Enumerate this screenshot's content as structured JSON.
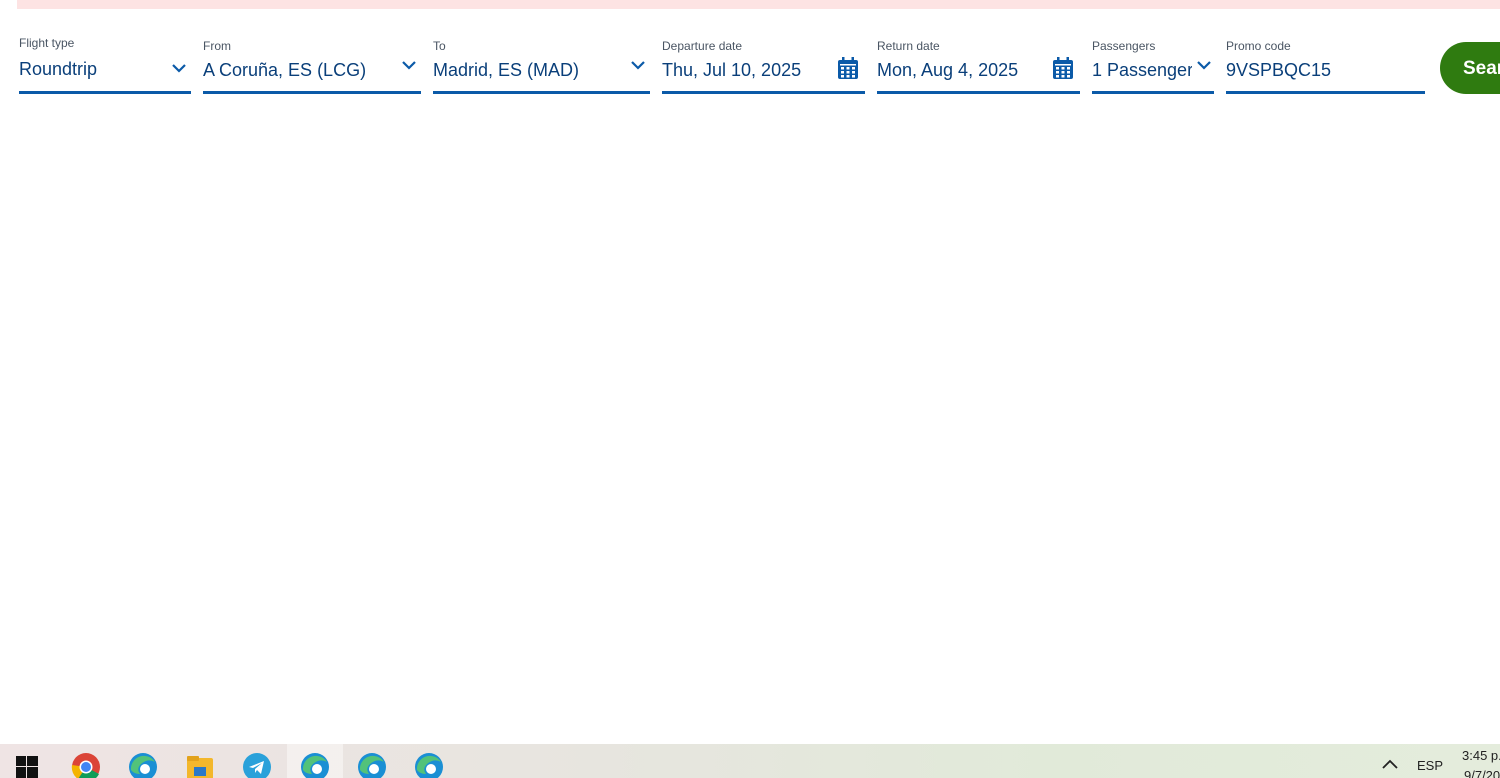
{
  "search_form": {
    "flight_type": {
      "label": "Flight type",
      "value": "Roundtrip"
    },
    "from": {
      "label": "From",
      "value": "A Coruña, ES (LCG)"
    },
    "to": {
      "label": "To",
      "value": "Madrid, ES (MAD)"
    },
    "departure_date": {
      "label": "Departure date",
      "value": "Thu, Jul 10, 2025"
    },
    "return_date": {
      "label": "Return date",
      "value": "Mon, Aug 4, 2025"
    },
    "passengers": {
      "label": "Passengers",
      "value": "1 Passenger"
    },
    "promo_code": {
      "label": "Promo code",
      "value": "9VSPBQC15"
    },
    "search_button_label": "Sear"
  },
  "taskbar": {
    "apps": [
      "windows-start-icon",
      "chrome-icon",
      "edge-icon",
      "file-explorer-icon",
      "telegram-icon",
      "edge-icon",
      "edge-icon",
      "edge-icon"
    ],
    "language": "ESP",
    "time": "3:45 p.",
    "date": "9/7/20"
  },
  "colors": {
    "accent_blue": "#0b5aa8",
    "text_blue": "#0a3f7a",
    "search_green": "#2f7b10",
    "alert_pink": "#fde3e3"
  }
}
